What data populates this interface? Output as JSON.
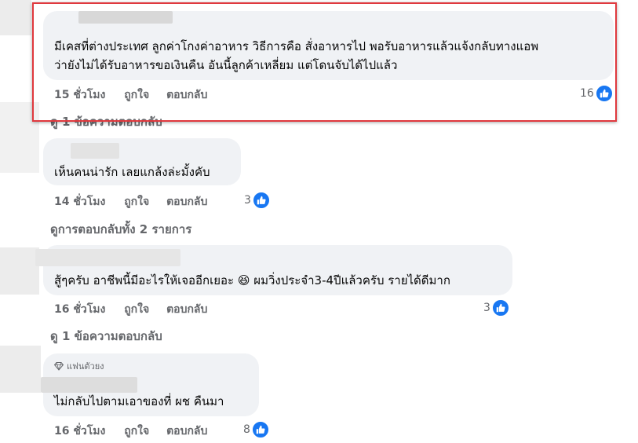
{
  "comments": [
    {
      "text_lines": [
        "มีเคสที่ต่างประเทศ ลูกค่าโกงค่าอาหาร วิธีการคือ สั่งอาหารไป พอรับอาหารแล้วแจ้งกลับทางแอพ",
        "ว่ายังไม่ได้รับอาหารขอเงินคืน อันนี้ลูกค้าเหลี่ยม แต่โดนจับได้ไปแล้ว"
      ],
      "time": "15 ชั่วโมง",
      "like_label": "ถูกใจ",
      "reply_label": "ตอบกลับ",
      "like_count": "16",
      "view_replies": "ดู 1 ข้อความตอบกลับ",
      "highlighted": true
    },
    {
      "text_lines": [
        "เห็นคนน่ารัก เลยแกล้งล่ะมั้งคับ"
      ],
      "time": "14 ชั่วโมง",
      "like_label": "ถูกใจ",
      "reply_label": "ตอบกลับ",
      "like_count": "3",
      "view_replies": "ดูการตอบกลับทั้ง 2 รายการ"
    },
    {
      "text_lines": [
        "สู้ๆครับ อาชีพนี้มีอะไรให้เจออีกเยอะ 😆  ผมวิ่งประจำ3-4ปีแล้วครับ รายได้ดีมาก"
      ],
      "time": "16 ชั่วโมง",
      "like_label": "ถูกใจ",
      "reply_label": "ตอบกลับ",
      "like_count": "3",
      "view_replies": "ดู 1 ข้อความตอบกลับ"
    },
    {
      "badge": "แฟนตัวยง",
      "text_lines": [
        "ไม่กลับไปตามเอาของที่ ผช คืนมา"
      ],
      "time": "16 ชั่วโมง",
      "like_label": "ถูกใจ",
      "reply_label": "ตอบกลับ",
      "like_count": "8"
    }
  ],
  "colors": {
    "bubble": "#f0f2f5",
    "meta_text": "#65676b",
    "like_blue": "#1877f2",
    "highlight_border": "#e0393e"
  },
  "icons": [
    "like-thumb-icon",
    "diamond-icon"
  ]
}
